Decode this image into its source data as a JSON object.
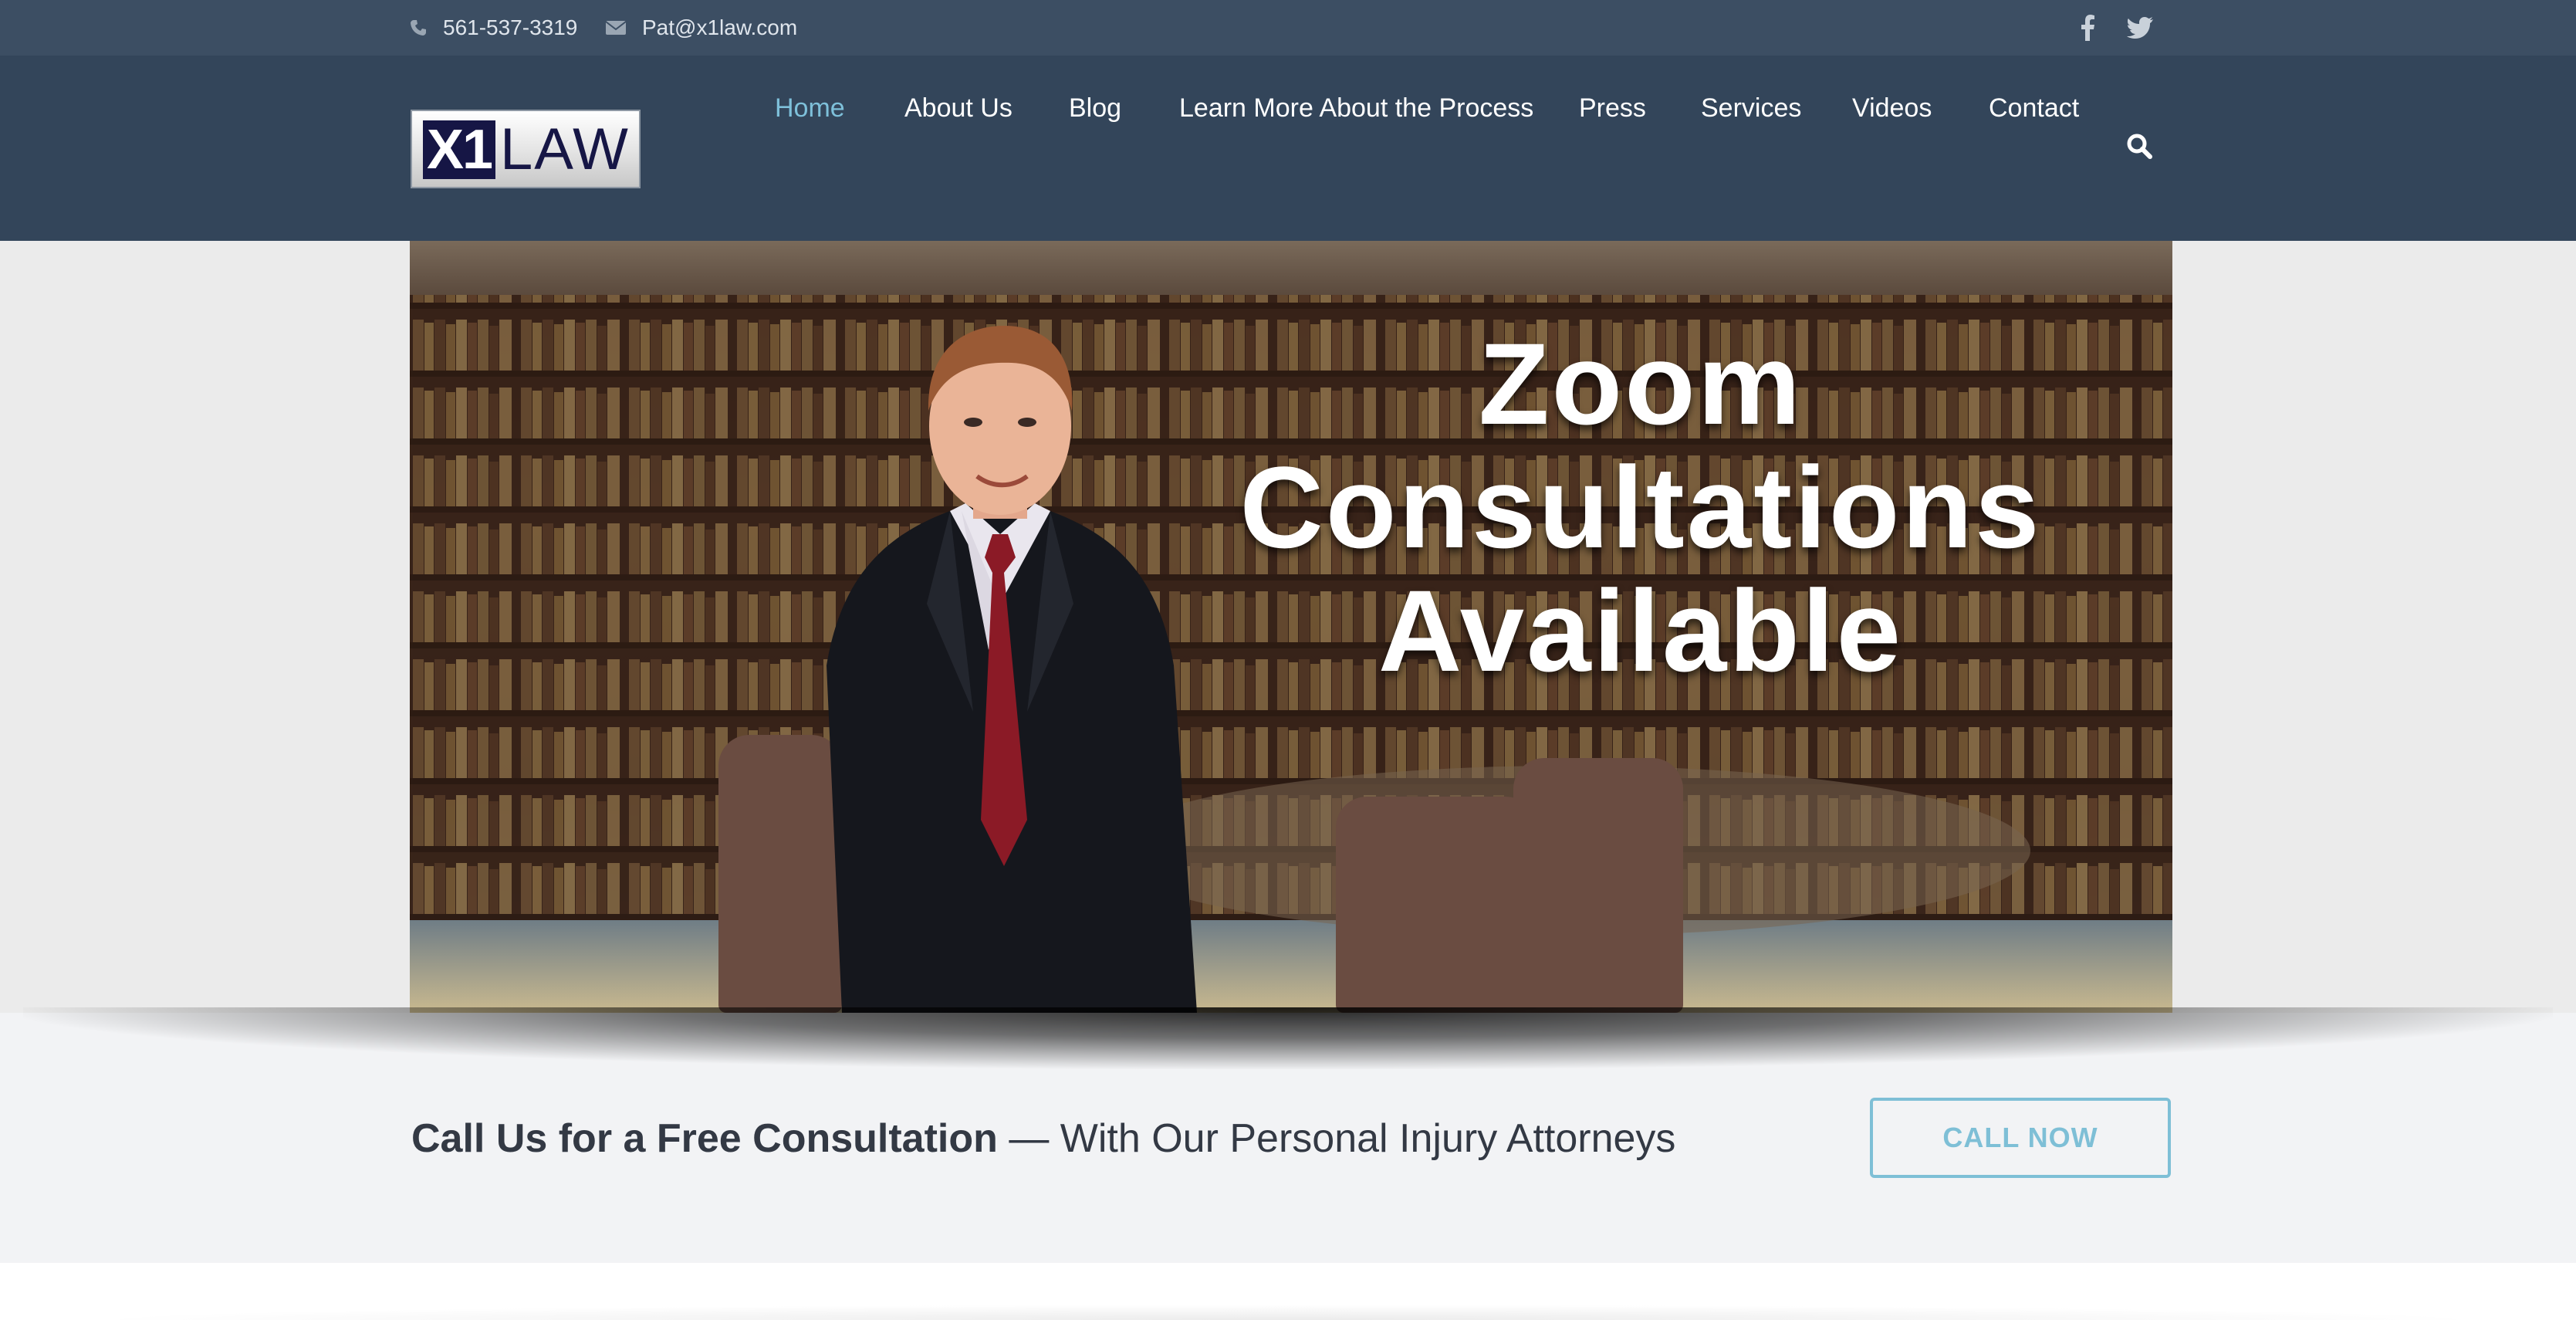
{
  "topbar": {
    "phone": "561-537-3319",
    "email": "Pat@x1law.com",
    "social": [
      "facebook-icon",
      "twitter-icon"
    ]
  },
  "header": {
    "logo": {
      "mark": "X1",
      "word": "LAW"
    },
    "nav": [
      {
        "label": "Home",
        "active": true
      },
      {
        "label": "About Us"
      },
      {
        "label": "Blog"
      },
      {
        "label": "Learn More About the Process"
      },
      {
        "label": "Press"
      },
      {
        "label": "Services"
      },
      {
        "label": "Videos"
      },
      {
        "label": "Contact"
      }
    ],
    "search_icon": "search-icon"
  },
  "hero": {
    "line1": "Zoom",
    "line2": "Consultations",
    "line3": "Available"
  },
  "cta": {
    "bold": "Call Us for a Free Consultation",
    "rest": " — With Our Personal Injury Attorneys",
    "button": "CALL NOW"
  },
  "colors": {
    "topbar": "#3c4e63",
    "header": "#33455a",
    "nav_active": "#7ec0da",
    "accent": "#7ebfd6"
  }
}
